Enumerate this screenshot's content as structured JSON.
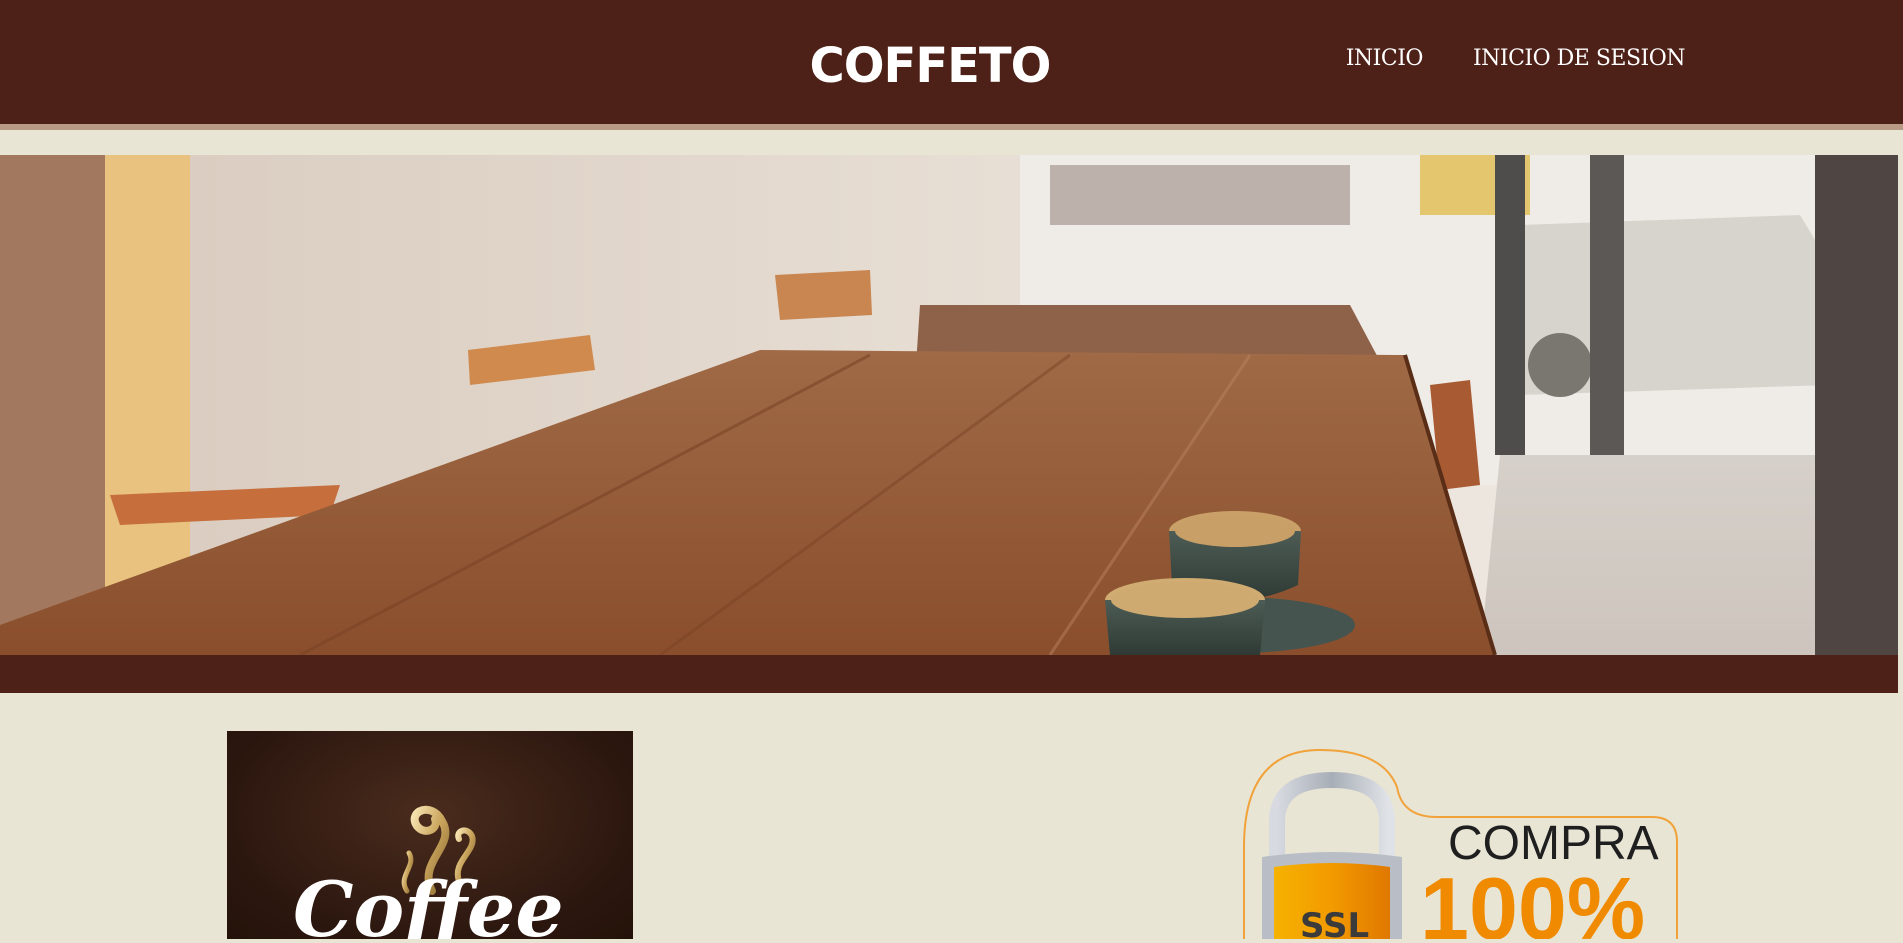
{
  "header": {
    "brand": "COFFETO",
    "nav": [
      {
        "label": "INICIO"
      },
      {
        "label": "INICIO DE SESION"
      }
    ]
  },
  "hero": {
    "image": "cafe-interior-photo"
  },
  "promo": {
    "logo_text": "Coffee",
    "ssl_badge": {
      "lock_label": "SSL",
      "title": "COMPRA",
      "percent": "100%"
    }
  },
  "colors": {
    "header_bg": "#4e2118",
    "page_bg": "#e8e5d5",
    "stripe": "#b89a86",
    "badge_orange": "#f08a00"
  }
}
